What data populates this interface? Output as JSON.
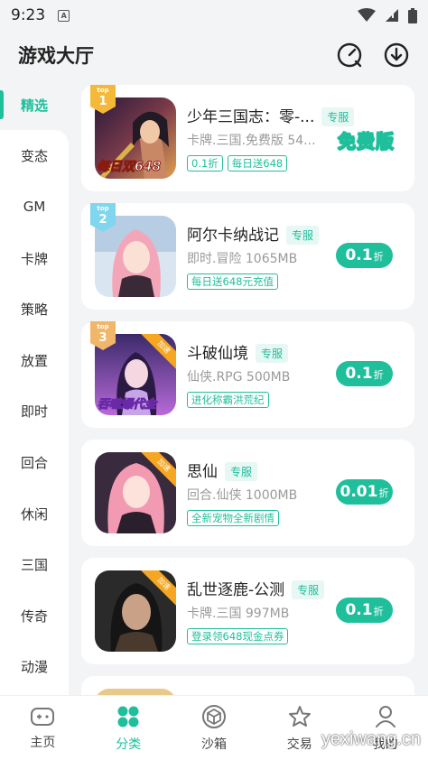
{
  "status": {
    "time": "9:23",
    "a_icon": "A"
  },
  "header": {
    "title": "游戏大厅",
    "icons": [
      "speed-search-icon",
      "download-icon"
    ]
  },
  "sidebar": {
    "items": [
      {
        "label": "精选"
      },
      {
        "label": "变态"
      },
      {
        "label": "GM"
      },
      {
        "label": "卡牌"
      },
      {
        "label": "策略"
      },
      {
        "label": "放置"
      },
      {
        "label": "即时"
      },
      {
        "label": "回合"
      },
      {
        "label": "休闲"
      },
      {
        "label": "三国"
      },
      {
        "label": "传奇"
      },
      {
        "label": "动漫"
      }
    ],
    "active": "精选"
  },
  "games": [
    {
      "rank": "1",
      "rank_label": "top",
      "title": "少年三国志：零-...",
      "badge": "专服",
      "meta": "卡牌.三国.免费版 54...",
      "tags": [
        "0.1折",
        "每日送648"
      ],
      "price_label": "免费版",
      "cover_text": "每日双648"
    },
    {
      "rank": "2",
      "rank_label": "top",
      "title": "阿尔卡纳战记",
      "badge": "专服",
      "meta": "即时.冒险 1065MB",
      "tags": [
        "每日送648元充值"
      ],
      "price": "0.1",
      "unit": "折"
    },
    {
      "rank": "3",
      "rank_label": "top",
      "title": "斗破仙境",
      "badge": "专服",
      "meta": "仙侠.RPG 500MB",
      "tags": [
        "进化称霸洪荒纪"
      ],
      "price": "0.1",
      "unit": "折",
      "cover_text": "吞噬爆代金",
      "corner": "加速"
    },
    {
      "title": "思仙",
      "badge": "专服",
      "meta": "回合.仙侠 1000MB",
      "tags": [
        "全新宠物全新剧情"
      ],
      "price": "0.01",
      "unit": "折",
      "corner": "加速"
    },
    {
      "title": "乱世逐鹿-公测",
      "badge": "专服",
      "meta": "卡牌.三国 997MB",
      "tags": [
        "登录领648现金点券"
      ],
      "price": "0.1",
      "unit": "折",
      "corner": "加速"
    }
  ],
  "bottom_nav": [
    {
      "label": "主页",
      "icon": "gamepad-icon"
    },
    {
      "label": "分类",
      "icon": "category-icon",
      "active": true
    },
    {
      "label": "沙箱",
      "icon": "sandbox-cube-icon"
    },
    {
      "label": "交易",
      "icon": "star-icon"
    },
    {
      "label": "我的",
      "icon": "user-icon"
    }
  ],
  "watermark": "yexiwang.cn",
  "colors": {
    "accent": "#1fbf9c",
    "background": "#f3f4f6",
    "rank1": "#f5b93a",
    "rank2": "#7fd6ee",
    "rank3": "#f2b66a"
  }
}
